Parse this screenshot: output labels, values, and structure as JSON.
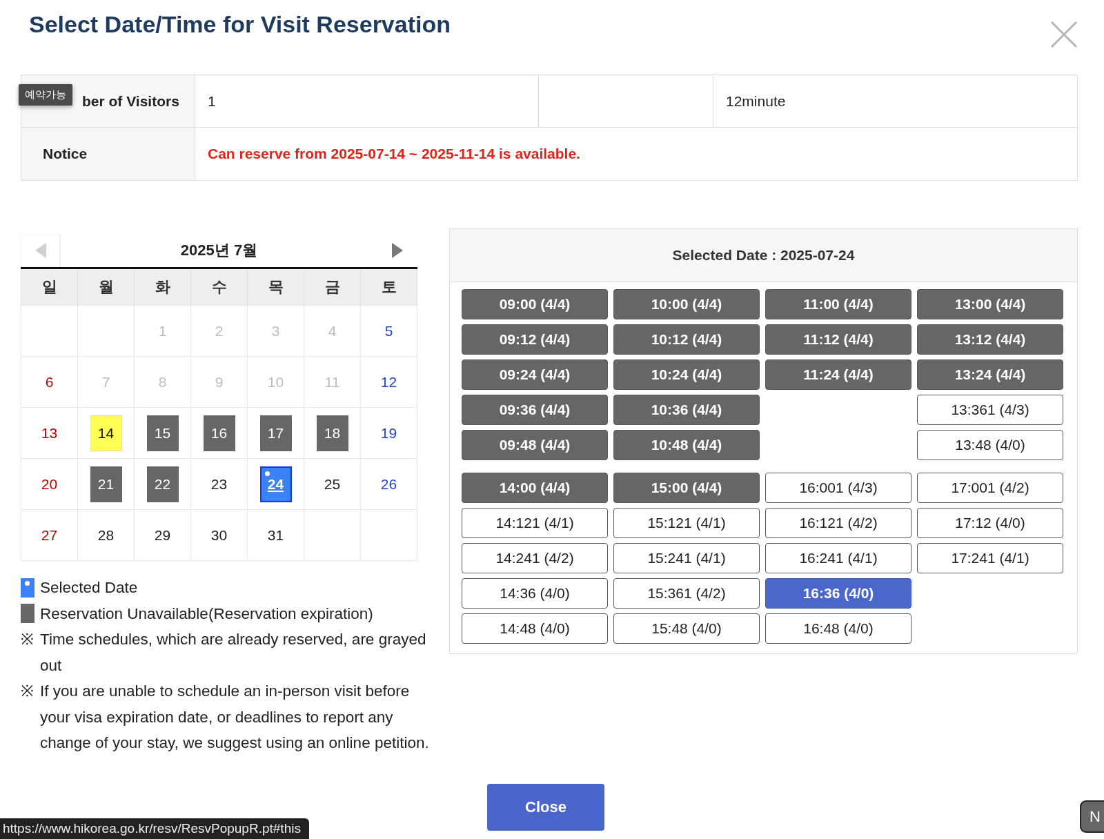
{
  "dialog": {
    "title": "Select Date/Time for Visit Reservation"
  },
  "tooltip": "예약가능",
  "info": {
    "visitors_label": "ber of Visitors",
    "visitors": "1",
    "duration": "12minute",
    "notice_label": "Notice",
    "notice": "Can reserve from 2025-07-14 ~ 2025-11-14 is available."
  },
  "calendar": {
    "title": "2025년 7월",
    "prev_disabled": true,
    "weekdays": [
      "일",
      "월",
      "화",
      "수",
      "목",
      "금",
      "토"
    ],
    "weeks": [
      [
        {
          "kind": "blank"
        },
        {
          "kind": "blank"
        },
        {
          "day": "1",
          "kind": "past",
          "selected": false
        },
        {
          "day": "2",
          "kind": "past",
          "selected": false
        },
        {
          "day": "3",
          "kind": "past",
          "selected": false
        },
        {
          "day": "4",
          "kind": "past",
          "selected": false
        },
        {
          "day": "5",
          "kind": "past",
          "selected": false
        }
      ],
      [
        {
          "day": "6",
          "kind": "past",
          "selected": false
        },
        {
          "day": "7",
          "kind": "past",
          "selected": false
        },
        {
          "day": "8",
          "kind": "past",
          "selected": false
        },
        {
          "day": "9",
          "kind": "past",
          "selected": false
        },
        {
          "day": "10",
          "kind": "past",
          "selected": false
        },
        {
          "day": "11",
          "kind": "past",
          "selected": false
        },
        {
          "day": "12",
          "kind": "past",
          "selected": false
        }
      ],
      [
        {
          "day": "13",
          "kind": "open",
          "selected": false
        },
        {
          "day": "14",
          "kind": "today",
          "selected": false
        },
        {
          "day": "15",
          "kind": "unavailable",
          "selected": false
        },
        {
          "day": "16",
          "kind": "unavailable",
          "selected": false
        },
        {
          "day": "17",
          "kind": "unavailable",
          "selected": false
        },
        {
          "day": "18",
          "kind": "unavailable",
          "selected": false
        },
        {
          "day": "19",
          "kind": "open",
          "selected": false
        }
      ],
      [
        {
          "day": "20",
          "kind": "open",
          "selected": false
        },
        {
          "day": "21",
          "kind": "unavailable",
          "selected": false
        },
        {
          "day": "22",
          "kind": "unavailable",
          "selected": false
        },
        {
          "day": "23",
          "kind": "open",
          "selected": false
        },
        {
          "day": "24",
          "kind": "open",
          "selected": true
        },
        {
          "day": "25",
          "kind": "open",
          "selected": false
        },
        {
          "day": "26",
          "kind": "open",
          "selected": false
        }
      ],
      [
        {
          "day": "27",
          "kind": "open",
          "selected": false
        },
        {
          "day": "28",
          "kind": "open",
          "selected": false
        },
        {
          "day": "29",
          "kind": "open",
          "selected": false
        },
        {
          "day": "30",
          "kind": "open",
          "selected": false
        },
        {
          "day": "31",
          "kind": "open",
          "selected": false
        },
        {
          "kind": "blank"
        },
        {
          "kind": "blank"
        }
      ]
    ]
  },
  "slots": {
    "title": "Selected Date : 2025-07-24",
    "groups": [
      {
        "columns": [
          [
            {
              "label": "09:00 (4/4)",
              "reserved": true,
              "selected": false
            },
            {
              "label": "09:12 (4/4)",
              "reserved": true,
              "selected": false
            },
            {
              "label": "09:24 (4/4)",
              "reserved": true,
              "selected": false
            },
            {
              "label": "09:36 (4/4)",
              "reserved": true,
              "selected": false
            },
            {
              "label": "09:48 (4/4)",
              "reserved": true,
              "selected": false
            }
          ],
          [
            {
              "label": "10:00 (4/4)",
              "reserved": true,
              "selected": false
            },
            {
              "label": "10:12 (4/4)",
              "reserved": true,
              "selected": false
            },
            {
              "label": "10:24 (4/4)",
              "reserved": true,
              "selected": false
            },
            {
              "label": "10:36 (4/4)",
              "reserved": true,
              "selected": false
            },
            {
              "label": "10:48 (4/4)",
              "reserved": true,
              "selected": false
            }
          ],
          [
            {
              "label": "11:00 (4/4)",
              "reserved": true,
              "selected": false
            },
            {
              "label": "11:12 (4/4)",
              "reserved": true,
              "selected": false
            },
            {
              "label": "11:24 (4/4)",
              "reserved": true,
              "selected": false
            }
          ],
          [
            {
              "label": "13:00 (4/4)",
              "reserved": true,
              "selected": false
            },
            {
              "label": "13:12 (4/4)",
              "reserved": true,
              "selected": false
            },
            {
              "label": "13:24 (4/4)",
              "reserved": true,
              "selected": false
            },
            {
              "label": "13:361 (4/3)",
              "reserved": false,
              "selected": false
            },
            {
              "label": "13:48 (4/0)",
              "reserved": false,
              "selected": false
            }
          ]
        ]
      },
      {
        "columns": [
          [
            {
              "label": "14:00 (4/4)",
              "reserved": true,
              "selected": false
            },
            {
              "label": "14:121 (4/1)",
              "reserved": false,
              "selected": false
            },
            {
              "label": "14:241 (4/2)",
              "reserved": false,
              "selected": false
            },
            {
              "label": "14:36 (4/0)",
              "reserved": false,
              "selected": false
            },
            {
              "label": "14:48 (4/0)",
              "reserved": false,
              "selected": false
            }
          ],
          [
            {
              "label": "15:00 (4/4)",
              "reserved": true,
              "selected": false
            },
            {
              "label": "15:121 (4/1)",
              "reserved": false,
              "selected": false
            },
            {
              "label": "15:241 (4/1)",
              "reserved": false,
              "selected": false
            },
            {
              "label": "15:361 (4/2)",
              "reserved": false,
              "selected": false
            },
            {
              "label": "15:48 (4/0)",
              "reserved": false,
              "selected": false
            }
          ],
          [
            {
              "label": "16:001 (4/3)",
              "reserved": false,
              "selected": false
            },
            {
              "label": "16:121 (4/2)",
              "reserved": false,
              "selected": false
            },
            {
              "label": "16:241 (4/1)",
              "reserved": false,
              "selected": false
            },
            {
              "label": "16:36 (4/0)",
              "reserved": false,
              "selected": true
            },
            {
              "label": "16:48 (4/0)",
              "reserved": false,
              "selected": false
            }
          ],
          [
            {
              "label": "17:001 (4/2)",
              "reserved": false,
              "selected": false
            },
            {
              "label": "17:12 (4/0)",
              "reserved": false,
              "selected": false
            },
            {
              "label": "17:241 (4/1)",
              "reserved": false,
              "selected": false
            }
          ]
        ]
      }
    ]
  },
  "legend": [
    {
      "kind": "selected",
      "text": "Selected Date"
    },
    {
      "kind": "unavailable",
      "text": "Reservation Unavailable(Reservation expiration)"
    }
  ],
  "notes": [
    {
      "mark": "※",
      "text": "Time schedules, which are already reserved, are grayed out"
    },
    {
      "mark": "※",
      "text": "If you are unable to schedule an in-person visit before your visa expiration date, or deadlines to report any change of your stay, we suggest using an online petition."
    }
  ],
  "close_button": "Close",
  "status_url": "https://www.hikorea.go.kr/resv/ResvPopupR.pt#this",
  "edge_button": "N"
}
